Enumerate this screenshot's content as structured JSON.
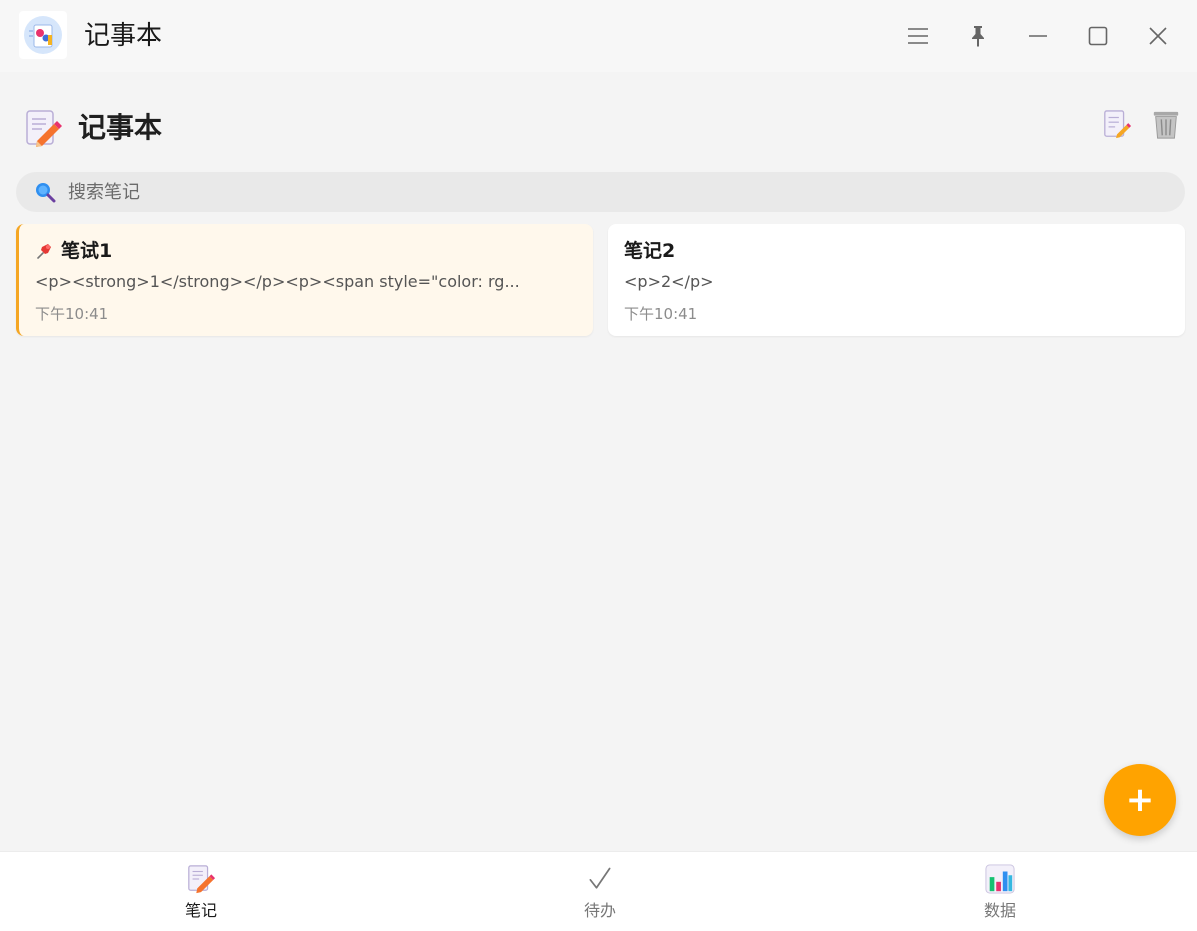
{
  "window": {
    "title": "记事本"
  },
  "header": {
    "title": "记事本"
  },
  "search": {
    "placeholder": "搜索笔记",
    "value": ""
  },
  "notes": [
    {
      "title": "笔试1",
      "preview": "<p><strong>1</strong></p><p><span style=\"color: rg...",
      "time": "下午10:41",
      "pinned": true
    },
    {
      "title": "笔记2",
      "preview": "<p>2</p>",
      "time": "下午10:41",
      "pinned": false
    }
  ],
  "fab": {
    "label": "+"
  },
  "nav": {
    "items": [
      {
        "label": "笔记",
        "icon": "notepad-pencil-icon",
        "active": true
      },
      {
        "label": "待办",
        "icon": "checkmark-icon",
        "active": false
      },
      {
        "label": "数据",
        "icon": "bar-chart-icon",
        "active": false
      }
    ]
  },
  "colors": {
    "accent": "#ffa300",
    "pinned_card_bg": "#fff8ec",
    "pinned_border": "#f5a623",
    "background": "#f4f4f4"
  }
}
